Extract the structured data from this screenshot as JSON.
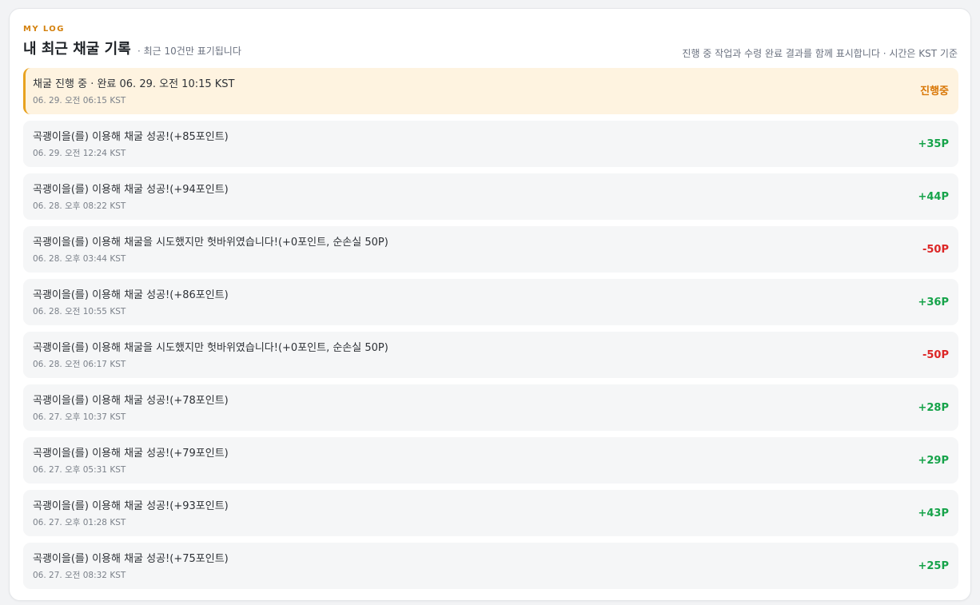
{
  "header": {
    "eyebrow": "MY LOG",
    "title": "내 최근 채굴 기록",
    "subtitle": "· 최근 10건만 표기됩니다",
    "note": "진행 중 작업과 수령 완료 결과를 함께 표시합니다 · 시간은 KST 기준"
  },
  "colors": {
    "accent": "#d4820f",
    "pending": "#d97706",
    "positive": "#16a34a",
    "negative": "#dc2626",
    "active_bg": "#fef3e0",
    "active_border": "#e8a21f"
  },
  "logs": [
    {
      "message": "채굴 진행 중 · 완료 06. 29. 오전 10:15 KST",
      "time": "06. 29. 오전 06:15 KST",
      "value": "진행중",
      "status": "pending"
    },
    {
      "message": "곡괭이을(를) 이용해 채굴 성공!(+85포인트)",
      "time": "06. 29. 오전 12:24 KST",
      "value": "+35P",
      "status": "positive"
    },
    {
      "message": "곡괭이을(를) 이용해 채굴 성공!(+94포인트)",
      "time": "06. 28. 오후 08:22 KST",
      "value": "+44P",
      "status": "positive"
    },
    {
      "message": "곡괭이을(를) 이용해 채굴을 시도했지만 헛바위였습니다!(+0포인트, 순손실 50P)",
      "time": "06. 28. 오후 03:44 KST",
      "value": "-50P",
      "status": "negative"
    },
    {
      "message": "곡괭이을(를) 이용해 채굴 성공!(+86포인트)",
      "time": "06. 28. 오전 10:55 KST",
      "value": "+36P",
      "status": "positive"
    },
    {
      "message": "곡괭이을(를) 이용해 채굴을 시도했지만 헛바위였습니다!(+0포인트, 순손실 50P)",
      "time": "06. 28. 오전 06:17 KST",
      "value": "-50P",
      "status": "negative"
    },
    {
      "message": "곡괭이을(를) 이용해 채굴 성공!(+78포인트)",
      "time": "06. 27. 오후 10:37 KST",
      "value": "+28P",
      "status": "positive"
    },
    {
      "message": "곡괭이을(를) 이용해 채굴 성공!(+79포인트)",
      "time": "06. 27. 오후 05:31 KST",
      "value": "+29P",
      "status": "positive"
    },
    {
      "message": "곡괭이을(를) 이용해 채굴 성공!(+93포인트)",
      "time": "06. 27. 오후 01:28 KST",
      "value": "+43P",
      "status": "positive"
    },
    {
      "message": "곡괭이을(를) 이용해 채굴 성공!(+75포인트)",
      "time": "06. 27. 오전 08:32 KST",
      "value": "+25P",
      "status": "positive"
    }
  ]
}
